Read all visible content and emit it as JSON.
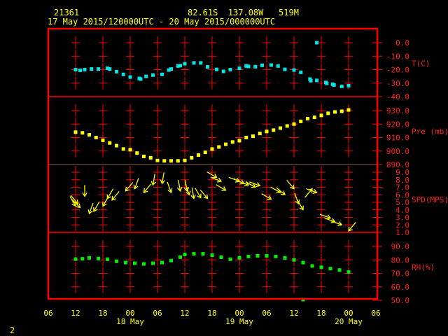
{
  "header": {
    "station_id": "21361",
    "location": "82.61S  137.08W   519M",
    "time_range": "17 May 2015/120000UTC - 20 May 2015/000000UTC"
  },
  "footer": {
    "page_number": "2"
  },
  "colors": {
    "frame": "#ff0000",
    "temp": "#00e5e5",
    "pressure": "#ffff00",
    "wind": "#ffff00",
    "rh": "#00ee00",
    "labels": "#ffff00",
    "axis_labels": "#ff2020"
  },
  "chart_data": {
    "type": "scatter",
    "title": "21361  82.61S 137.08W 519M",
    "subtitle": "17 May 2015/120000UTC - 20 May 2015/000000UTC",
    "x_units": "hours since 17 May 2015 12Z",
    "xlim": [
      -6,
      66
    ],
    "x_tick_labels": [
      "06",
      "12",
      "18",
      "00",
      "06",
      "12",
      "18",
      "00",
      "06",
      "12",
      "18",
      "00",
      "06"
    ],
    "date_labels": [
      {
        "label": "18 May",
        "hour": 12
      },
      {
        "label": "19 May",
        "hour": 36
      },
      {
        "label": "20 May",
        "hour": 60
      }
    ],
    "panels": [
      {
        "name": "T(C)",
        "ylim": [
          -40,
          0
        ],
        "ticks": [
          "0.0",
          "-10.0",
          "-20.0",
          "-30.0",
          "-40.0"
        ],
        "tick_values": [
          0,
          -10,
          -20,
          -30,
          -40
        ],
        "x": [
          0,
          1,
          2,
          3.5,
          5,
          7,
          7.5,
          9,
          10.5,
          12,
          14,
          14.3,
          15.5,
          17,
          19,
          20.5,
          21,
          22.5,
          23,
          24,
          26,
          27.5,
          29,
          31,
          32.5,
          34,
          36,
          37.5,
          38,
          39.5,
          41,
          43,
          44.5,
          46,
          48,
          49.5,
          51.5,
          51.7,
          53,
          53,
          55,
          55.2,
          56.5,
          56.8,
          58.5,
          60
        ],
        "y": [
          -20,
          -20.5,
          -20,
          -19.5,
          -19.5,
          -19,
          -19.5,
          -21.5,
          -23.5,
          -25.5,
          -26.5,
          -27,
          -25,
          -24,
          -23.5,
          -20.3,
          -19.5,
          -17.3,
          -17,
          -15.6,
          -15,
          -15,
          -18,
          -19.8,
          -21.3,
          -20,
          -19,
          -17.3,
          -17.6,
          -17.8,
          -16.8,
          -16.6,
          -17.3,
          -19.8,
          -20.3,
          -22,
          -27,
          -28.2,
          -28,
          0,
          -29.5,
          -30.2,
          -30.8,
          -31.4,
          -32.4,
          -31.9
        ]
      },
      {
        "name": "Pre (mb)",
        "ylim": [
          890,
          930
        ],
        "ticks": [
          "930.0",
          "920.0",
          "910.0",
          "900.0",
          "890.0"
        ],
        "tick_values": [
          930,
          920,
          910,
          900,
          890
        ],
        "x": [
          0,
          1.5,
          3,
          4.5,
          6,
          7.5,
          9,
          10.5,
          12,
          13.5,
          15,
          16.5,
          18,
          19.5,
          21,
          22.5,
          24,
          25.5,
          27,
          28.5,
          30,
          31.5,
          33,
          34.5,
          36,
          37.5,
          39,
          40.5,
          42,
          43.5,
          45,
          46.5,
          48,
          49.5,
          51,
          52.5,
          54,
          55.5,
          57,
          58.5,
          60
        ],
        "y": [
          914,
          913.5,
          912,
          910,
          908,
          906,
          904,
          901.5,
          901,
          898.5,
          896,
          895,
          893,
          892.7,
          892.7,
          892.7,
          893,
          895,
          897,
          899,
          901.5,
          903,
          905,
          906.7,
          907.7,
          910,
          911,
          913,
          914.5,
          915.5,
          917,
          918.6,
          920,
          922,
          924,
          925,
          926.4,
          928,
          929,
          929.5,
          930.5
        ]
      },
      {
        "name": "SPD(MPS)",
        "ylim": [
          1,
          9
        ],
        "ticks": [
          "9.0",
          "8.0",
          "7.0",
          "6.0",
          "5.0",
          "4.0",
          "3.0",
          "2.0",
          "1.0"
        ],
        "tick_values": [
          9,
          8,
          7,
          6,
          5,
          4,
          3,
          2,
          1
        ],
        "x": [
          0,
          0.5,
          1,
          2,
          3,
          4,
          6,
          7,
          8,
          11,
          13,
          15,
          17,
          19,
          21,
          23,
          24.5,
          25,
          26,
          27.5,
          29,
          31,
          32,
          33,
          36,
          37,
          38,
          39.5,
          40.5,
          43,
          45,
          46,
          48,
          49,
          50,
          52,
          53,
          56,
          57,
          58.5,
          60
        ],
        "y": [
          4.5,
          4.8,
          4.3,
          5.8,
          3.5,
          3.8,
          4.5,
          5.5,
          5.3,
          6.5,
          6.8,
          6.3,
          7.3,
          7.5,
          6.3,
          6.5,
          6.5,
          6,
          5.5,
          5.6,
          5.5,
          8.3,
          7.8,
          6.6,
          7.8,
          7.5,
          7.3,
          7,
          7.2,
          5.4,
          6.3,
          6,
          6.8,
          4.8,
          4,
          6.8,
          6.3,
          2.9,
          2.4,
          2,
          1.2
        ],
        "direction_deg": [
          150,
          140,
          135,
          180,
          200,
          210,
          210,
          210,
          220,
          220,
          200,
          220,
          190,
          190,
          160,
          170,
          170,
          160,
          170,
          150,
          140,
          120,
          110,
          120,
          110,
          115,
          110,
          120,
          110,
          120,
          120,
          130,
          140,
          160,
          150,
          40,
          110,
          110,
          110,
          110,
          220
        ]
      },
      {
        "name": "RH(%)",
        "ylim": [
          50,
          90
        ],
        "ticks": [
          "90.0",
          "80.0",
          "70.0",
          "60.0",
          "50.0"
        ],
        "tick_values": [
          90,
          80,
          70,
          60,
          50
        ],
        "x": [
          0,
          1.5,
          3,
          5,
          7,
          9,
          11,
          13,
          15,
          17,
          19,
          21,
          23,
          24,
          26,
          28,
          30,
          32,
          34,
          36,
          38,
          40,
          42,
          44,
          46,
          48,
          50,
          50,
          52,
          54,
          56,
          58,
          60
        ],
        "y": [
          80.6,
          80.8,
          81.5,
          81,
          80.5,
          79,
          78,
          77.5,
          77,
          77.5,
          78,
          79.5,
          82,
          84,
          84.5,
          84.5,
          83.5,
          82,
          80.5,
          81.5,
          82.5,
          83,
          83,
          82.5,
          81.5,
          80,
          78,
          50.5,
          75.5,
          74.5,
          73.5,
          72.5,
          71
        ]
      }
    ]
  }
}
